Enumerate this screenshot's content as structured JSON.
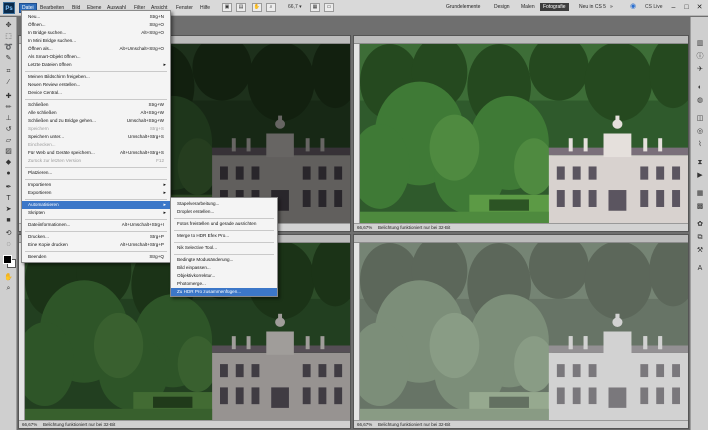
{
  "app": {
    "logo_text": "Ps"
  },
  "menubar": {
    "items": [
      "Datei",
      "Bearbeiten",
      "Bild",
      "Ebene",
      "Auswahl",
      "Filter",
      "Ansicht",
      "Fenster",
      "Hilfe"
    ],
    "zoom_level": "66,7",
    "workspaces": [
      "Grundelemente",
      "Design",
      "Malen",
      "Fotografie",
      "Neu in CS 5"
    ],
    "active_workspace": "Fotografie",
    "cs_live": "CS Live"
  },
  "datei_menu": {
    "items": [
      {
        "label": "Neu...",
        "shortcut": "Strg+N"
      },
      {
        "label": "Öffnen...",
        "shortcut": "Strg+O"
      },
      {
        "label": "In Bridge suchen...",
        "shortcut": "Alt+Strg+O"
      },
      {
        "label": "In Mini Bridge suchen...",
        "shortcut": ""
      },
      {
        "label": "Öffnen als...",
        "shortcut": "Alt+Umschalt+Strg+O"
      },
      {
        "label": "Als Smart-Objekt öffnen...",
        "shortcut": ""
      },
      {
        "label": "Letzte Dateien öffnen",
        "shortcut": "",
        "submenu": true
      },
      {
        "label": "Meinen Bildschirm freigeben...",
        "shortcut": ""
      },
      {
        "label": "Neuen Review erstellen...",
        "shortcut": ""
      },
      {
        "label": "Device Central...",
        "shortcut": ""
      },
      {
        "label": "Schließen",
        "shortcut": "Strg+W"
      },
      {
        "label": "Alle schließen",
        "shortcut": "Alt+Strg+W"
      },
      {
        "label": "Schließen und zu Bridge gehen...",
        "shortcut": "Umschalt+Strg+W"
      },
      {
        "label": "Speichern",
        "shortcut": "Strg+S",
        "disabled": true
      },
      {
        "label": "Speichern unter...",
        "shortcut": "Umschalt+Strg+S"
      },
      {
        "label": "Einchecken...",
        "shortcut": "",
        "disabled": true
      },
      {
        "label": "Für Web und Geräte speichern...",
        "shortcut": "Alt+Umschalt+Strg+S"
      },
      {
        "label": "Zurück zur letzten Version",
        "shortcut": "F12",
        "disabled": true
      },
      {
        "label": "Platzieren...",
        "shortcut": ""
      },
      {
        "label": "Importieren",
        "shortcut": "",
        "submenu": true
      },
      {
        "label": "Exportieren",
        "shortcut": "",
        "submenu": true
      },
      {
        "label": "Automatisieren",
        "shortcut": "",
        "submenu": true
      },
      {
        "label": "Skripten",
        "shortcut": "",
        "submenu": true
      },
      {
        "label": "Dateiinformationen...",
        "shortcut": "Alt+Umschalt+Strg+I"
      },
      {
        "label": "Drucken...",
        "shortcut": "Strg+P"
      },
      {
        "label": "Eine Kopie drucken",
        "shortcut": "Alt+Umschalt+Strg+P"
      },
      {
        "label": "Beenden",
        "shortcut": "Strg+Q"
      }
    ]
  },
  "automate_submenu": {
    "items": [
      {
        "label": "Stapelverarbeitung..."
      },
      {
        "label": "Droplet erstellen..."
      },
      {
        "label": "Fotos freistellen und gerade ausrichten"
      },
      {
        "label": "Merge to HDR Efex Pro..."
      },
      {
        "label": "Nik Selective Tool..."
      },
      {
        "label": "Bedingte Modusänderung..."
      },
      {
        "label": "Bild einpassen..."
      },
      {
        "label": "Objektivkorrektur..."
      },
      {
        "label": "Photomerge..."
      },
      {
        "label": "Zu HDR Pro zusammenfügen..."
      }
    ]
  },
  "documents": [
    {
      "zoom": "66,67%",
      "status": "Belichtung funktioniert nur bei 32-Bit"
    },
    {
      "zoom": "66,67%",
      "status": "Belichtung funktioniert nur bei 32-Bit"
    },
    {
      "zoom": "66,67%",
      "status": "Belichtung funktioniert nur bei 32-Bit"
    },
    {
      "zoom": "66,67%",
      "status": "Belichtung funktioniert nur bei 32-Bit"
    }
  ],
  "icons": {
    "tools": [
      "move-icon",
      "marquee-icon",
      "lasso-icon",
      "quick-select-icon",
      "crop-icon",
      "eyedropper-icon",
      "healing-icon",
      "brush-icon",
      "clone-stamp-icon",
      "history-brush-icon",
      "eraser-icon",
      "gradient-icon",
      "blur-icon",
      "dodge-icon",
      "pen-icon",
      "type-icon",
      "path-select-icon",
      "shape-icon",
      "3d-rotate-icon",
      "3d-orbit-icon",
      "hand-icon",
      "zoom-icon"
    ],
    "panels": [
      "histogram-icon",
      "info-icon",
      "navigator-icon",
      "adjustments-icon",
      "masks-icon",
      "layers-icon",
      "channels-icon",
      "paths-icon",
      "history-icon",
      "actions-icon",
      "swatches-icon",
      "styles-icon",
      "brushes-icon",
      "clone-source-icon",
      "tool-presets-icon",
      "character-icon"
    ]
  },
  "colors": {
    "menu_highlight": "#3c77c8",
    "foreground_swatch": "#000000",
    "background_swatch": "#ffffff"
  }
}
